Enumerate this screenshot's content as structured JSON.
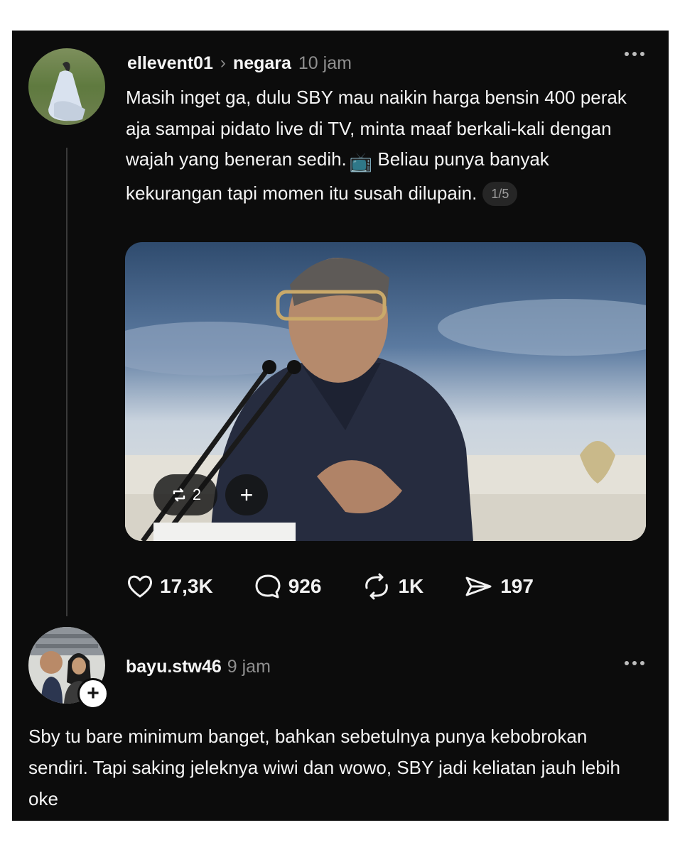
{
  "post": {
    "username": "ellevent01",
    "separator": "›",
    "community": "negara",
    "time": "10 jam",
    "text": "Masih inget ga, dulu SBY mau naikin harga bensin 400 perak aja sampai pidato live di TV, minta maaf berkali-kali dengan wajah yang beneran sedih.",
    "text_emoji": "📺",
    "text_2": " Beliau punya banyak kekurangan tapi momen itu susah dilupain.",
    "page_indicator": "1/5",
    "media": {
      "repost_count": "2",
      "add_label": "+"
    },
    "actions": {
      "likes": "17,3K",
      "comments": "926",
      "reposts": "1K",
      "shares": "197"
    }
  },
  "reply": {
    "username": "bayu.stw46",
    "time": "9 jam",
    "follow_label": "+",
    "text": "Sby tu bare minimum banget, bahkan sebetulnya punya kebobrokan sendiri. Tapi saking jeleknya wiwi dan wowo, SBY jadi keliatan jauh lebih oke"
  },
  "icons": {
    "like": "heart-icon",
    "comment": "comment-bubble-icon",
    "repost": "repost-icon",
    "share": "send-icon",
    "more": "more-dots-icon"
  },
  "colors": {
    "background": "#0c0c0c",
    "text": "#f5f5f5",
    "muted": "#8f8f8f"
  }
}
